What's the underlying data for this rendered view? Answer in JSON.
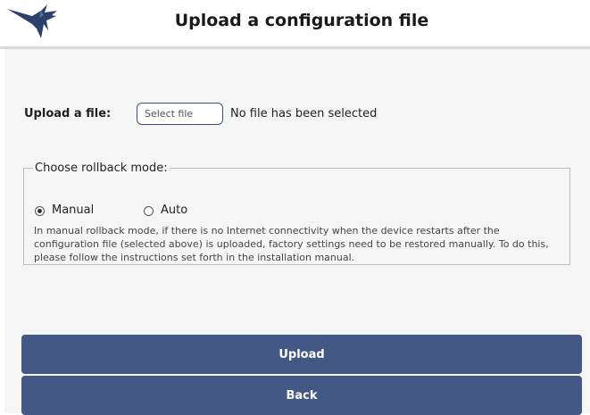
{
  "header": {
    "logo_icon": "hummingbird-logo-icon",
    "title": "Upload a configuration file"
  },
  "upload": {
    "label": "Upload a file:",
    "select_button": "Select file",
    "status": "No file has been selected"
  },
  "rollback": {
    "legend": "Choose rollback mode:",
    "options": [
      {
        "label": "Manual",
        "checked": true
      },
      {
        "label": "Auto",
        "checked": false
      }
    ],
    "description": "In manual rollback mode, if there is no Internet connectivity when the device restarts after the configuration file (selected above) is uploaded, factory settings need to be restored manually. To do this, please follow the instructions set forth in the installation manual."
  },
  "actions": {
    "upload": "Upload",
    "back": "Back"
  },
  "colors": {
    "button_bg": "#445886",
    "logo": "#2d3f6b",
    "panel_bg": "#f5f5f5"
  }
}
